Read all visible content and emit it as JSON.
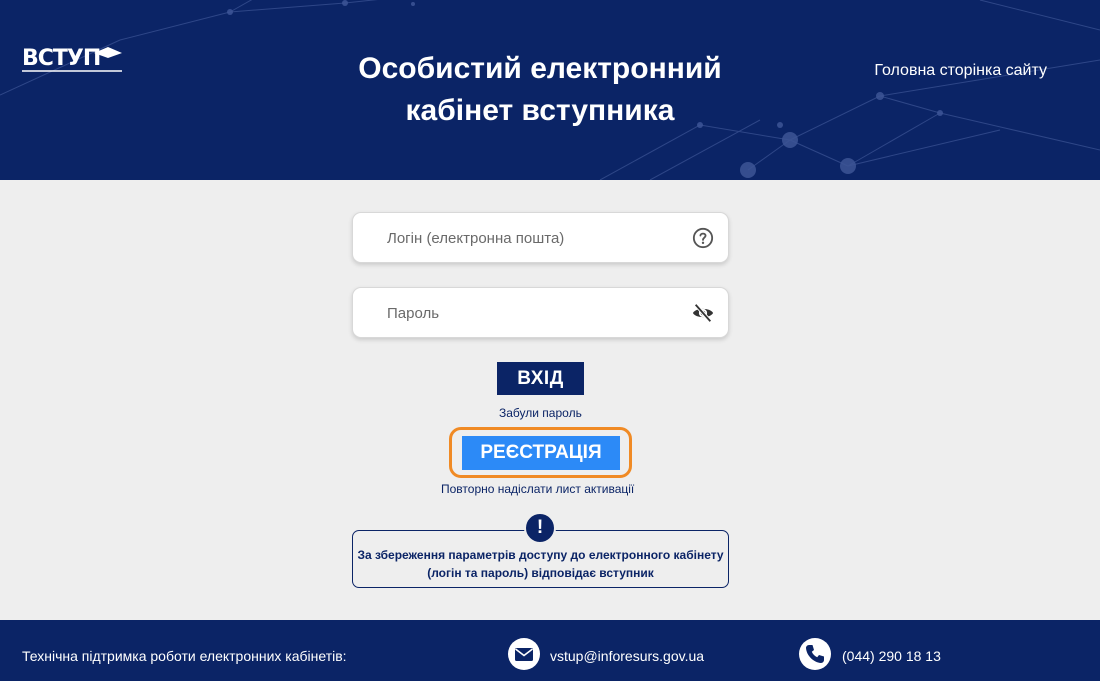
{
  "header": {
    "logo_text": "ВСТУП",
    "title_line1": "Особистий електронний",
    "title_line2": "кабінет вступника",
    "home_link": "Головна сторінка сайту"
  },
  "form": {
    "login_placeholder": "Логін (електронна пошта)",
    "login_value": "",
    "password_placeholder": "Пароль",
    "password_value": "",
    "login_button": "ВХІД",
    "forgot_password": "Забули пароль",
    "register_button": "РЕЄСТРАЦІЯ",
    "resend_activation": "Повторно надіслати лист активації"
  },
  "notice": {
    "badge": "!",
    "line1": "За збереження параметрів доступу до електронного кабінету",
    "line2": "(логін та пароль) відповідає вступник"
  },
  "footer": {
    "support_label": "Технічна підтримка роботи електронних кабінетів:",
    "email": "vstup@inforesurs.gov.ua",
    "phone": "(044) 290 18 13"
  },
  "icons": {
    "login_help": "question-circle-icon",
    "password_toggle": "eye-slash-icon",
    "email": "envelope-icon",
    "phone": "phone-icon"
  },
  "colors": {
    "primary_navy": "#0b2466",
    "register_blue": "#2c8af7",
    "highlight_orange": "#f08a24",
    "background": "#eeeeee"
  }
}
